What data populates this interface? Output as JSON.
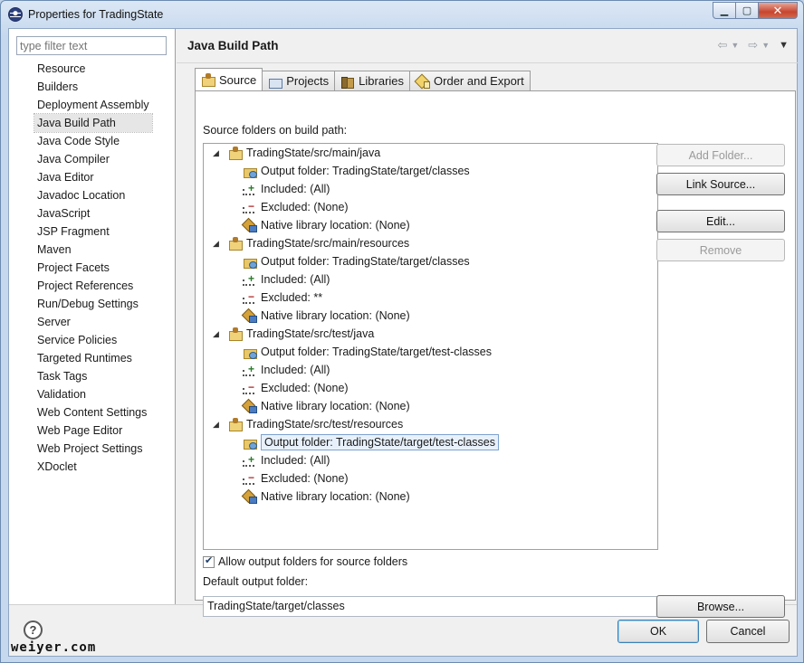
{
  "window": {
    "title": "Properties for TradingState"
  },
  "filter": {
    "placeholder": "type filter text"
  },
  "nav": [
    "Resource",
    "Builders",
    "Deployment Assembly",
    "Java Build Path",
    "Java Code Style",
    "Java Compiler",
    "Java Editor",
    "Javadoc Location",
    "JavaScript",
    "JSP Fragment",
    "Maven",
    "Project Facets",
    "Project References",
    "Run/Debug Settings",
    "Server",
    "Service Policies",
    "Targeted Runtimes",
    "Task Tags",
    "Validation",
    "Web Content Settings",
    "Web Page Editor",
    "Web Project Settings",
    "XDoclet"
  ],
  "nav_selected": "Java Build Path",
  "page": {
    "title": "Java Build Path"
  },
  "tabs": {
    "source": "Source",
    "projects": "Projects",
    "libraries": "Libraries",
    "order": "Order and Export"
  },
  "source_label": "Source folders on build path:",
  "tree": {
    "src_main_java": {
      "label": "TradingState/src/main/java",
      "output": "Output folder: TradingState/target/classes",
      "included": "Included: (All)",
      "excluded": "Excluded: (None)",
      "native": "Native library location: (None)"
    },
    "src_main_resources": {
      "label": "TradingState/src/main/resources",
      "output": "Output folder: TradingState/target/classes",
      "included": "Included: (All)",
      "excluded": "Excluded: **",
      "native": "Native library location: (None)"
    },
    "src_test_java": {
      "label": "TradingState/src/test/java",
      "output": "Output folder: TradingState/target/test-classes",
      "included": "Included: (All)",
      "excluded": "Excluded: (None)",
      "native": "Native library location: (None)"
    },
    "src_test_resources": {
      "label": "TradingState/src/test/resources",
      "output": "Output folder: TradingState/target/test-classes",
      "included": "Included: (All)",
      "excluded": "Excluded: (None)",
      "native": "Native library location: (None)"
    }
  },
  "buttons": {
    "add_folder": "Add Folder...",
    "link_source": "Link Source...",
    "edit": "Edit...",
    "remove": "Remove",
    "browse": "Browse...",
    "ok": "OK",
    "cancel": "Cancel"
  },
  "allow_output": {
    "label": "Allow output folders for source folders",
    "checked": true
  },
  "default_output": {
    "label": "Default output folder:",
    "value": "TradingState/target/classes"
  },
  "watermark": "weiyer.com",
  "colors": {
    "accent": "#3c7fb1",
    "selection": "#e8f1fb"
  }
}
